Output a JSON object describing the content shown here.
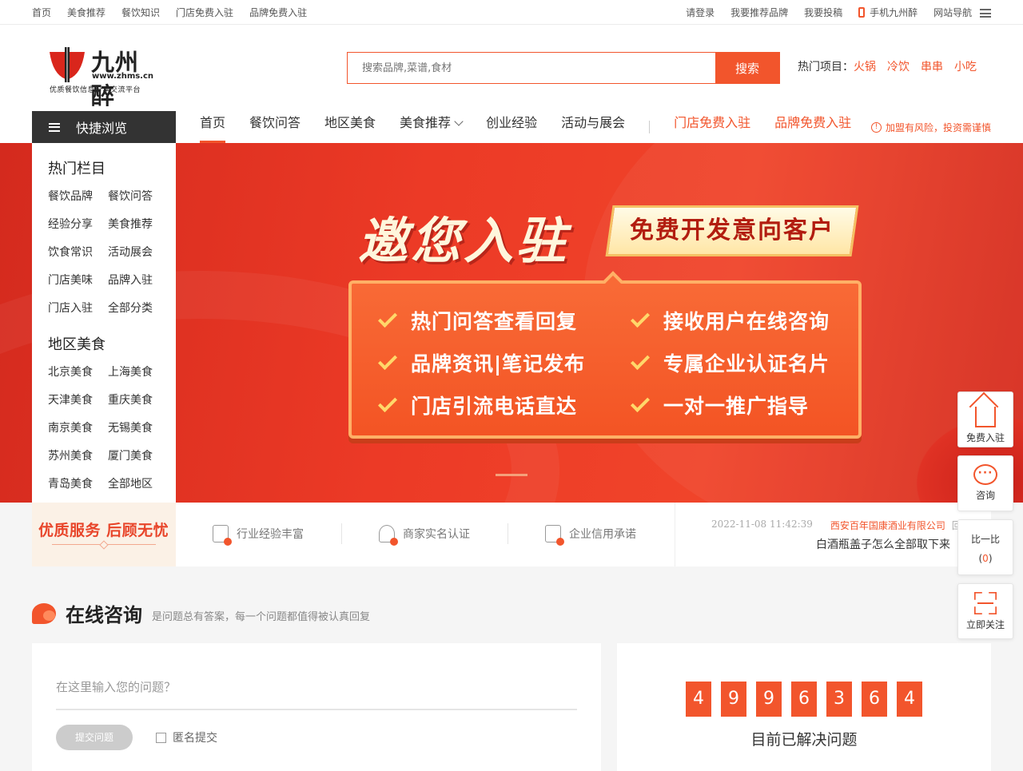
{
  "topbar": {
    "left": [
      "首页",
      "美食推荐",
      "餐饮知识",
      "门店免费入驻",
      "品牌免费入驻"
    ],
    "login": "请登录",
    "recommend_brand": "我要推荐品牌",
    "submit": "我要投稿",
    "mobile": "手机九州醉",
    "site_nav": "网站导航"
  },
  "logo": {
    "name": "九州醉",
    "url": "www.zhms.cn",
    "slogan": "优质餐饮信息分享交流平台"
  },
  "search": {
    "placeholder": "搜索品牌,菜谱,食材",
    "button": "搜索"
  },
  "hot": {
    "label": "热门项目：",
    "items": [
      "火锅",
      "冷饮",
      "串串",
      "小吃"
    ]
  },
  "nav": {
    "quick_browse": "快捷浏览",
    "links": [
      "首页",
      "餐饮问答",
      "地区美食",
      "美食推荐",
      "创业经验",
      "活动与展会"
    ],
    "red_links": [
      "门店免费入驻",
      "品牌免费入驻"
    ],
    "risk": "加盟有风险，投资需谨慎",
    "active_index": 0
  },
  "sidebar": {
    "hot_title": "热门栏目",
    "hot_items": [
      "餐饮品牌",
      "餐饮问答",
      "经验分享",
      "美食推荐",
      "饮食常识",
      "活动展会",
      "门店美味",
      "品牌入驻",
      "门店入驻",
      "全部分类"
    ],
    "region_title": "地区美食",
    "region_items": [
      "北京美食",
      "上海美食",
      "天津美食",
      "重庆美食",
      "南京美食",
      "无锡美食",
      "苏州美食",
      "厦门美食",
      "青岛美食",
      "全部地区"
    ]
  },
  "banner": {
    "title": "邀您入驻",
    "tag": "免费开发意向客户",
    "features": [
      "热门问答查看回复",
      "接收用户在线咨询",
      "品牌资讯|笔记发布",
      "专属企业认证名片",
      "门店引流电话直达",
      "一对一推广指导"
    ]
  },
  "featbar": {
    "slogan": "优质服务 后顾无忧",
    "items": [
      "行业经验丰富",
      "商家实名认证",
      "企业信用承诺"
    ],
    "news": {
      "time": "2022-11-08 11:42:39",
      "company": "西安百年国康酒业有限公司",
      "action": "回复",
      "question": "白酒瓶盖子怎么全部取下来"
    }
  },
  "consult": {
    "title": "在线咨询",
    "subtitle": "是问题总有答案，每一个问题都值得被认真回复",
    "input_placeholder": "在这里输入您的问题？",
    "submit": "提交问题",
    "anonymous": "匿名提交"
  },
  "counter": {
    "digits": [
      "4",
      "9",
      "9",
      "6",
      "3",
      "6",
      "4"
    ],
    "label": "目前已解决问题"
  },
  "float": {
    "join": "免费入驻",
    "consult": "咨询",
    "compare": "比一比",
    "compare_count": "0",
    "follow": "立即关注"
  },
  "colors": {
    "accent": "#f2552c",
    "dark": "#333333"
  }
}
